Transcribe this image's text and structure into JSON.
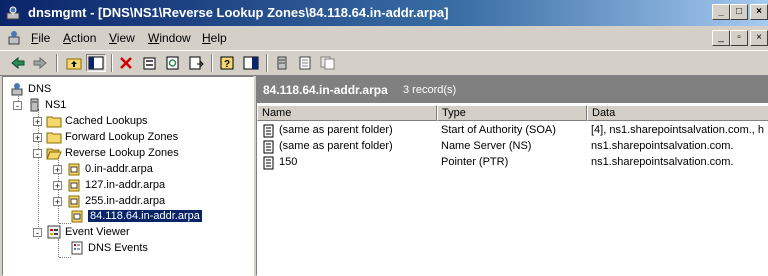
{
  "window": {
    "title": "dnsmgmt - [DNS\\NS1\\Reverse Lookup Zones\\84.118.64.in-addr.arpa]",
    "minimize_glyph": "_",
    "maximize_glyph": "□",
    "close_glyph": "×"
  },
  "menu": {
    "items": [
      {
        "accel": "F",
        "rest": "ile"
      },
      {
        "accel": "A",
        "rest": "ction"
      },
      {
        "accel": "V",
        "rest": "iew"
      },
      {
        "accel": "W",
        "rest": "indow"
      },
      {
        "accel": "H",
        "rest": "elp"
      }
    ],
    "mdi_minimize": "_",
    "mdi_restore": "▫",
    "mdi_close": "×"
  },
  "toolbar": {
    "icons": [
      "back-arrow-icon",
      "forward-arrow-icon",
      "up-folder-icon",
      "show-hide-tree-icon",
      "delete-icon",
      "properties-icon",
      "refresh-icon",
      "export-list-icon",
      "help-icon",
      "action-pane-icon",
      "server-icon",
      "document-icon",
      "copy-icon"
    ]
  },
  "tree": {
    "root": "DNS",
    "server": "NS1",
    "cached": "Cached Lookups",
    "forward": "Forward Lookup Zones",
    "reverse": "Reverse Lookup Zones",
    "zone0": "0.in-addr.arpa",
    "zone127": "127.in-addr.arpa",
    "zone255": "255.in-addr.arpa",
    "zone84": "84.118.64.in-addr.arpa",
    "event_viewer": "Event Viewer",
    "dns_events": "DNS Events",
    "plus": "+",
    "minus": "-"
  },
  "result": {
    "zone_title": "84.118.64.in-addr.arpa",
    "record_count": "3 record(s)",
    "columns": [
      "Name",
      "Type",
      "Data"
    ],
    "rows": [
      {
        "name": "(same as parent folder)",
        "type": "Start of Authority (SOA)",
        "data": "[4], ns1.sharepointsalvation.com., h"
      },
      {
        "name": "(same as parent folder)",
        "type": "Name Server (NS)",
        "data": "ns1.sharepointsalvation.com."
      },
      {
        "name": "150",
        "type": "Pointer (PTR)",
        "data": "ns1.sharepointsalvation.com."
      }
    ]
  }
}
